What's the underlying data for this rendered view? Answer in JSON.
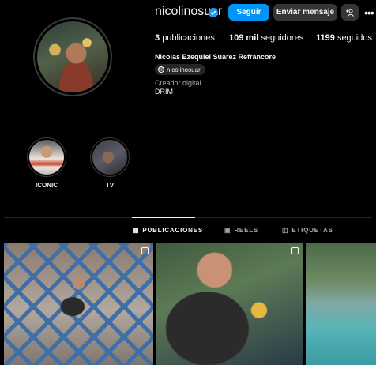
{
  "profile": {
    "username": "nicolinosuar",
    "verified": true,
    "full_name": "Nicolas Ezequiel Suarez Refrancore",
    "threads_handle": "nicolinosuar",
    "category": "Creador digital",
    "bio": "DRIM"
  },
  "buttons": {
    "follow": "Seguir",
    "message": "Enviar mensaje",
    "add_user_icon": "add-user-icon",
    "more_icon": "more-options-icon"
  },
  "stats": {
    "posts_count": "3",
    "posts_label": "publicaciones",
    "followers_count": "109 mil",
    "followers_label": "seguidores",
    "following_count": "1199",
    "following_label": "seguidos"
  },
  "highlights": [
    {
      "label": "ICONIC"
    },
    {
      "label": "TV"
    }
  ],
  "tabs": [
    {
      "label": "PUBLICACIONES",
      "icon": "grid-icon",
      "active": true
    },
    {
      "label": "REELS",
      "icon": "reels-icon",
      "active": false
    },
    {
      "label": "ETIQUETAS",
      "icon": "tag-icon",
      "active": false
    }
  ],
  "colors": {
    "accent": "#0095f6",
    "verified": "#1d9bf0",
    "background": "#000000"
  }
}
